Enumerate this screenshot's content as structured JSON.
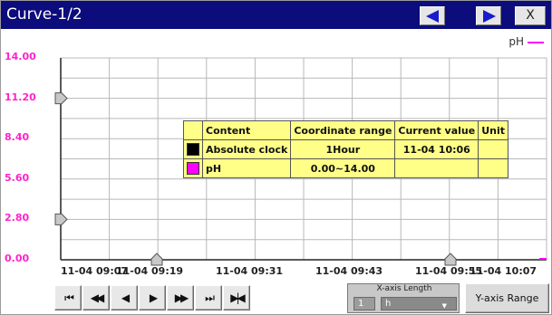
{
  "window": {
    "title": "Curve-1/2",
    "close_label": "X"
  },
  "legend": {
    "label": "pH",
    "color": "#ff00ff"
  },
  "chart_data": {
    "type": "line",
    "y_tick_labels": [
      "14.00",
      "11.20",
      "8.40",
      "5.60",
      "2.80",
      "0.00"
    ],
    "ylim": [
      0,
      14
    ],
    "x_tick_labels": [
      "11-04 09:07",
      "11-04 09:19",
      "11-04 09:31",
      "11-04 09:43",
      "11-04 09:55",
      "11-04 10:07"
    ],
    "grid": true,
    "series": [
      {
        "name": "pH",
        "color": "#ff00ff",
        "values": []
      }
    ]
  },
  "info_table": {
    "headers": [
      "Content",
      "Coordinate range",
      "Current value",
      "Unit"
    ],
    "rows": [
      {
        "swatch": "#000000",
        "content": "Absolute clock",
        "range": "1Hour",
        "current": "11-04 10:06",
        "unit": ""
      },
      {
        "swatch": "#ff00ff",
        "content": "pH",
        "range": "0.00~14.00",
        "current": "",
        "unit": ""
      }
    ]
  },
  "navigation": {
    "buttons": [
      {
        "name": "first-page-icon",
        "glyph": "⏮"
      },
      {
        "name": "fast-back-icon",
        "glyph": "◀◀"
      },
      {
        "name": "step-back-icon",
        "glyph": "◀"
      },
      {
        "name": "step-forward-icon",
        "glyph": "▶"
      },
      {
        "name": "fast-forward-icon",
        "glyph": "▶▶"
      },
      {
        "name": "last-page-icon",
        "glyph": "⏭"
      },
      {
        "name": "jump-icon",
        "glyph": "▶|◀"
      }
    ]
  },
  "x_axis_length": {
    "title": "X-axis Length",
    "value": "1",
    "unit": "h",
    "arrow": "▼"
  },
  "y_range_button": "Y-axis Range"
}
